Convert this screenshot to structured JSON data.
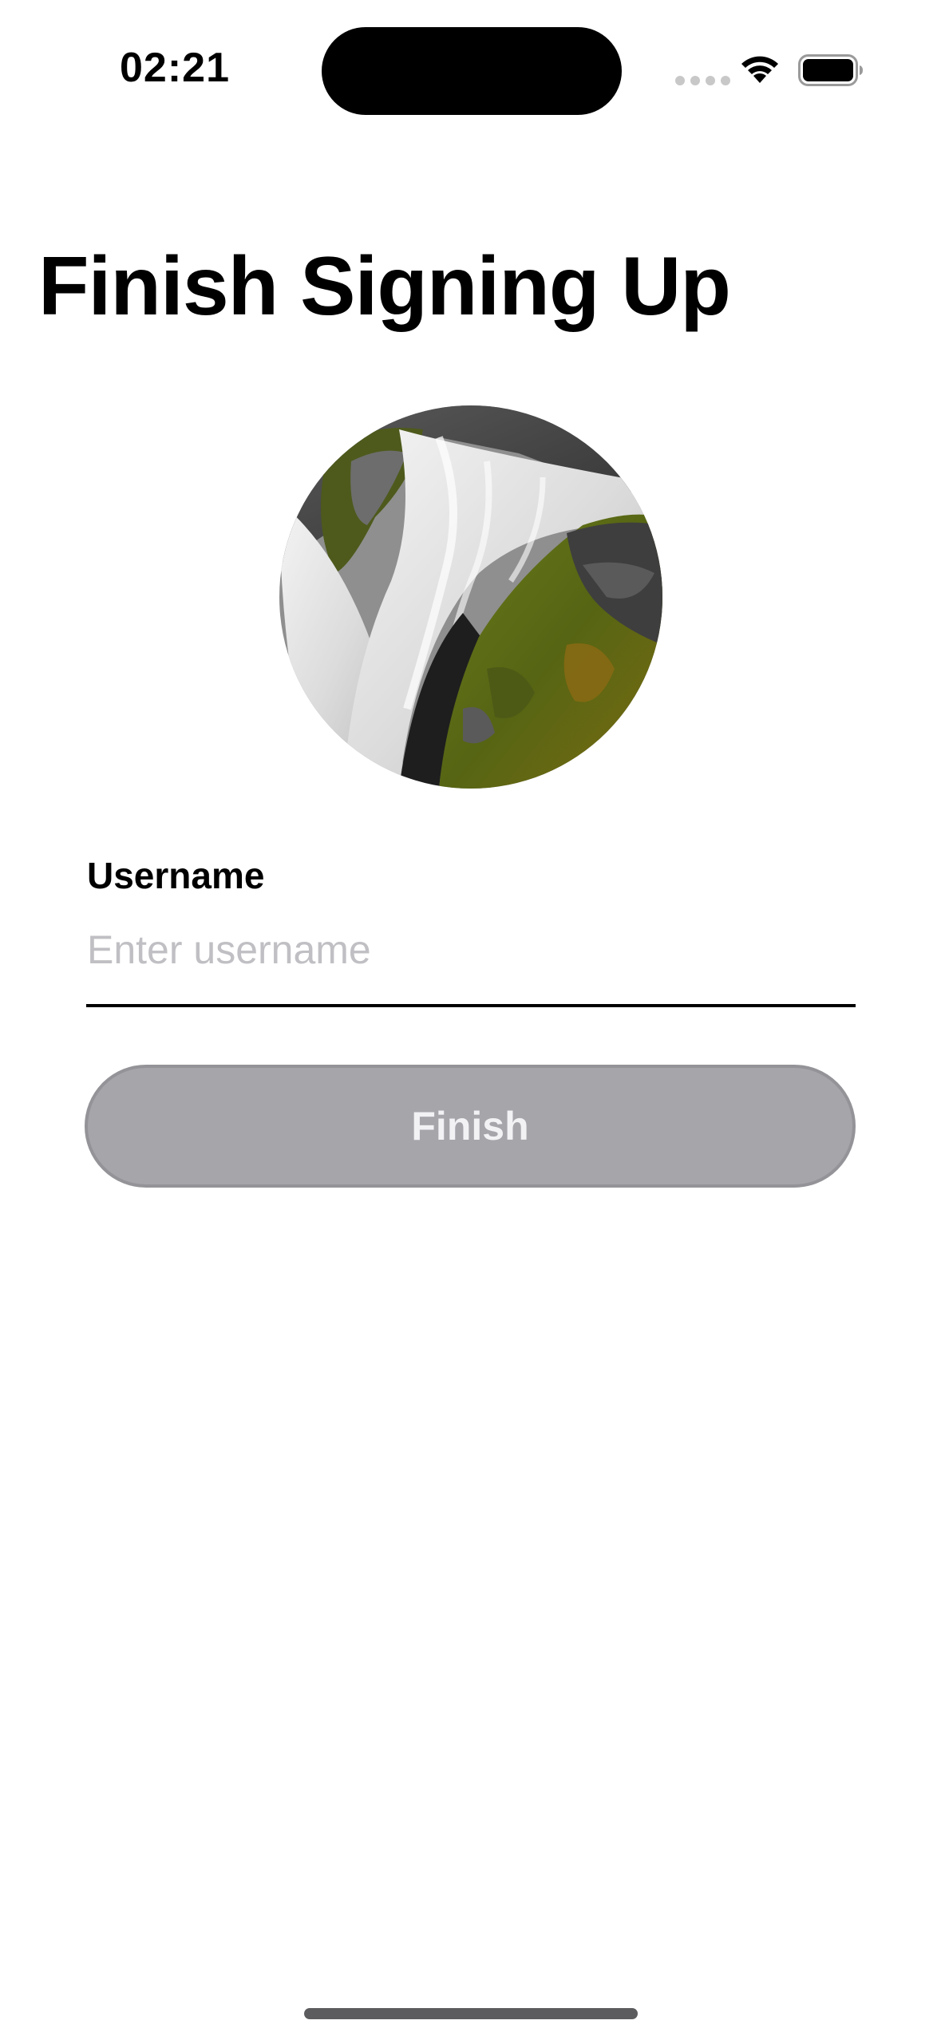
{
  "status_bar": {
    "time": "02:21",
    "icons": [
      "cellular-signal-icon",
      "wifi-icon",
      "battery-icon"
    ]
  },
  "page": {
    "title": "Finish Signing Up"
  },
  "avatar": {
    "description_icon": "profile-photo-waterfall"
  },
  "form": {
    "username_label": "Username",
    "username_value": "",
    "username_placeholder": "Enter username",
    "finish_label": "Finish"
  },
  "colors": {
    "button_disabled_bg": "#a5a5aa",
    "button_text": "#f2f2f5",
    "placeholder": "#c0c0c4",
    "text": "#000000",
    "background": "#ffffff"
  }
}
